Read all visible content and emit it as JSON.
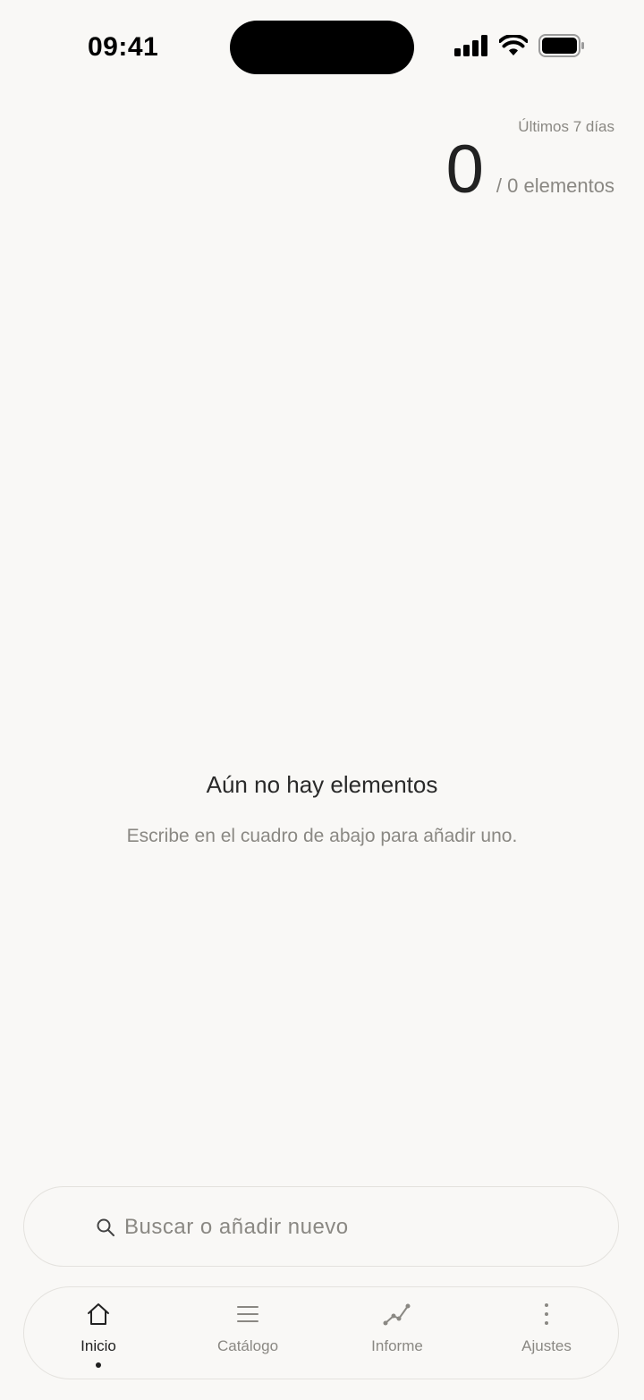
{
  "status_bar": {
    "time": "09:41"
  },
  "stats": {
    "period": "Últimos 7 días",
    "count": "0",
    "total": "/ 0 elementos"
  },
  "empty_state": {
    "title": "Aún no hay elementos",
    "subtitle": "Escribe en el cuadro de abajo para añadir uno."
  },
  "search": {
    "placeholder": "Buscar o añadir nuevo",
    "value": "",
    "icon": "search-icon"
  },
  "tabs": [
    {
      "label": "Inicio",
      "icon": "home-icon",
      "active": true
    },
    {
      "label": "Catálogo",
      "icon": "list-icon",
      "active": false
    },
    {
      "label": "Informe",
      "icon": "chart-line-icon",
      "active": false
    },
    {
      "label": "Ajustes",
      "icon": "more-vertical-icon",
      "active": false
    }
  ],
  "colors": {
    "background": "#f9f8f6",
    "text_primary": "#222222",
    "text_secondary": "#8a8883",
    "border": "#e4e2de"
  }
}
